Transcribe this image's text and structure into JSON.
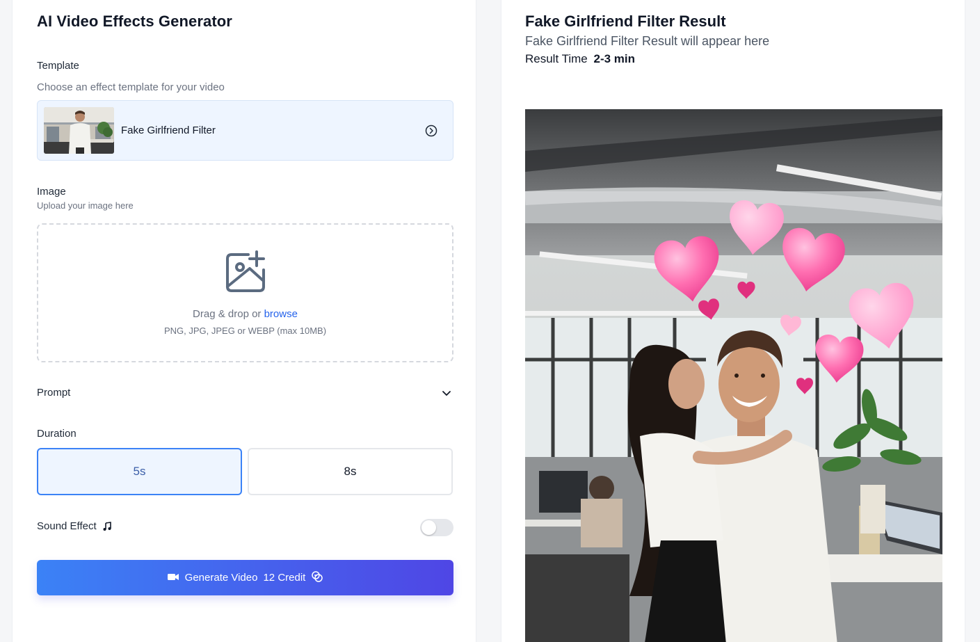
{
  "left": {
    "title": "AI Video Effects Generator",
    "template": {
      "label": "Template",
      "hint": "Choose an effect template for your video",
      "selected": "Fake Girlfriend Filter"
    },
    "image": {
      "label": "Image",
      "hint": "Upload your image here",
      "drop_text": "Drag & drop or",
      "browse": "browse",
      "formats": "PNG, JPG, JPEG or WEBP (max 10MB)"
    },
    "prompt": {
      "label": "Prompt"
    },
    "duration": {
      "label": "Duration",
      "options": [
        "5s",
        "8s"
      ],
      "selected": "5s"
    },
    "sound": {
      "label": "Sound Effect",
      "enabled": false
    },
    "generate": {
      "label": "Generate Video",
      "credit": "12 Credit"
    }
  },
  "right": {
    "title": "Fake Girlfriend Filter Result",
    "subtitle": "Fake Girlfriend Filter Result will appear here",
    "time_label": "Result Time",
    "time_value": "2-3 min"
  },
  "colors": {
    "accent": "#3b82f6",
    "gradient_end": "#4f46e5",
    "selected_bg": "#eef5ff"
  },
  "icons": [
    "circle-arrow-right-icon",
    "image-plus-icon",
    "chevron-down-icon",
    "music-note-icon",
    "video-camera-icon",
    "coins-icon"
  ]
}
